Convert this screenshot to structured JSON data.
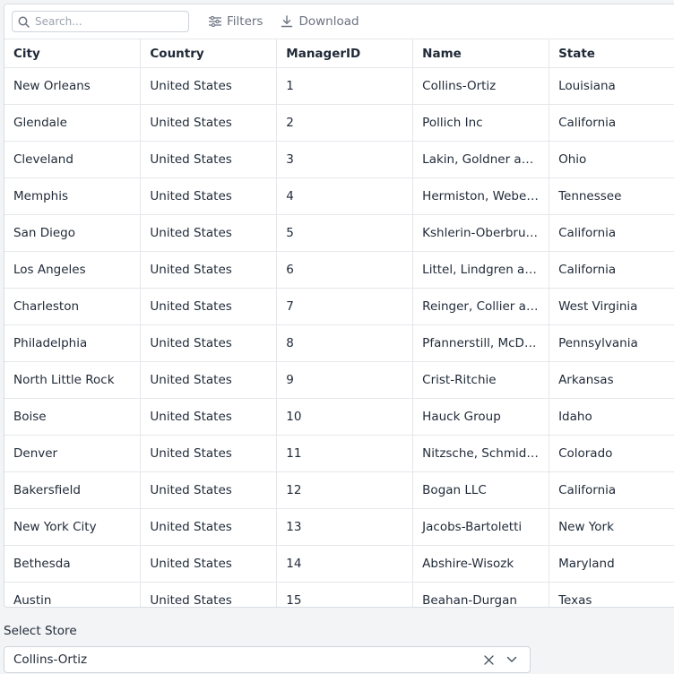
{
  "toolbar": {
    "search_placeholder": "Search...",
    "filters_label": "Filters",
    "download_label": "Download"
  },
  "table": {
    "columns": [
      "City",
      "Country",
      "ManagerID",
      "Name",
      "State"
    ],
    "rows": [
      [
        "New Orleans",
        "United States",
        "1",
        "Collins-Ortiz",
        "Louisiana"
      ],
      [
        "Glendale",
        "United States",
        "2",
        "Pollich Inc",
        "California"
      ],
      [
        "Cleveland",
        "United States",
        "3",
        "Lakin, Goldner and...",
        "Ohio"
      ],
      [
        "Memphis",
        "United States",
        "4",
        "Hermiston, Weber ...",
        "Tennessee"
      ],
      [
        "San Diego",
        "United States",
        "5",
        "Kshlerin-Oberbrun...",
        "California"
      ],
      [
        "Los Angeles",
        "United States",
        "6",
        "Littel, Lindgren an...",
        "California"
      ],
      [
        "Charleston",
        "United States",
        "7",
        "Reinger, Collier an...",
        "West Virginia"
      ],
      [
        "Philadelphia",
        "United States",
        "8",
        "Pfannerstill, McDe...",
        "Pennsylvania"
      ],
      [
        "North Little Rock",
        "United States",
        "9",
        "Crist-Ritchie",
        "Arkansas"
      ],
      [
        "Boise",
        "United States",
        "10",
        "Hauck Group",
        "Idaho"
      ],
      [
        "Denver",
        "United States",
        "11",
        "Nitzsche, Schmidt ...",
        "Colorado"
      ],
      [
        "Bakersfield",
        "United States",
        "12",
        "Bogan LLC",
        "California"
      ],
      [
        "New York City",
        "United States",
        "13",
        "Jacobs-Bartoletti",
        "New York"
      ],
      [
        "Bethesda",
        "United States",
        "14",
        "Abshire-Wisozk",
        "Maryland"
      ],
      [
        "Austin",
        "United States",
        "15",
        "Beahan-Durgan",
        "Texas"
      ]
    ]
  },
  "select_store": {
    "label": "Select Store",
    "value": "Collins-Ortiz"
  },
  "icons": {
    "search": "search-icon",
    "filters": "filter-lines-icon",
    "download": "download-icon",
    "clear": "close-icon",
    "dropdown": "chevron-down-icon"
  }
}
